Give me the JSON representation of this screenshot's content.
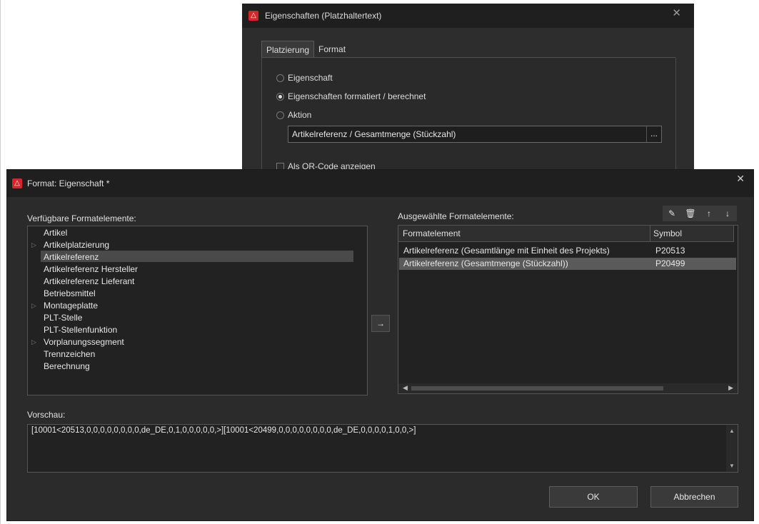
{
  "background_dialog": {
    "title": "Eigenschaften (Platzhaltertext)",
    "close_icon": "close-icon",
    "tabs": [
      "Platzierung",
      "Format"
    ],
    "options": [
      {
        "label": "Eigenschaft",
        "checked": false
      },
      {
        "label": "Eigenschaften formatiert / berechnet",
        "checked": true
      },
      {
        "label": "Aktion",
        "checked": false
      }
    ],
    "combo_value": "Artikelreferenz / Gesamtmenge (Stückzahl)",
    "combo_button": "...",
    "checkbox_label": "Als QR-Code anzeigen"
  },
  "main_dialog": {
    "title": "Format: Eigenschaft *",
    "available_label": "Verfügbare Formatelemente:",
    "available_items": [
      {
        "label": "Artikel",
        "expandable": false,
        "selected": false
      },
      {
        "label": "Artikelplatzierung",
        "expandable": true,
        "selected": false
      },
      {
        "label": "Artikelreferenz",
        "expandable": false,
        "selected": true
      },
      {
        "label": "Artikelreferenz Hersteller",
        "expandable": false,
        "selected": false
      },
      {
        "label": "Artikelreferenz Lieferant",
        "expandable": false,
        "selected": false
      },
      {
        "label": "Betriebsmittel",
        "expandable": false,
        "selected": false
      },
      {
        "label": "Montageplatte",
        "expandable": true,
        "selected": false
      },
      {
        "label": "PLT-Stelle",
        "expandable": false,
        "selected": false
      },
      {
        "label": "PLT-Stellenfunktion",
        "expandable": false,
        "selected": false
      },
      {
        "label": "Vorplanungssegment",
        "expandable": true,
        "selected": false
      },
      {
        "label": "Trennzeichen",
        "expandable": false,
        "selected": false
      },
      {
        "label": "Berechnung",
        "expandable": false,
        "selected": false
      }
    ],
    "move_button": "→",
    "selected_label": "Ausgewählte Formatelemente:",
    "toolbar": {
      "edit": "✎",
      "delete": "🗑",
      "up": "↑",
      "down": "↓"
    },
    "grid_columns": [
      "Formatelement",
      "Symbol"
    ],
    "grid_rows": [
      {
        "element": "Artikelreferenz (Gesamtlänge mit Einheit des Projekts)",
        "symbol": "P20513",
        "selected": false
      },
      {
        "element": "Artikelreferenz (Gesamtmenge (Stückzahl))",
        "symbol": "P20499",
        "selected": true
      }
    ],
    "preview_label": "Vorschau:",
    "preview_text": "[10001<20513,0,0,0,0,0,0,0,0,de_DE,0,1,0,0,0,0,0,>][10001<20499,0,0,0,0,0,0,0,0,de_DE,0,0,0,0,1,0,0,>]",
    "ok_label": "OK",
    "cancel_label": "Abbrechen"
  },
  "colors": {
    "accent": "#d7262a",
    "dialog_bg": "#2b2b2b",
    "titlebar_bg": "#1f1f1f"
  }
}
